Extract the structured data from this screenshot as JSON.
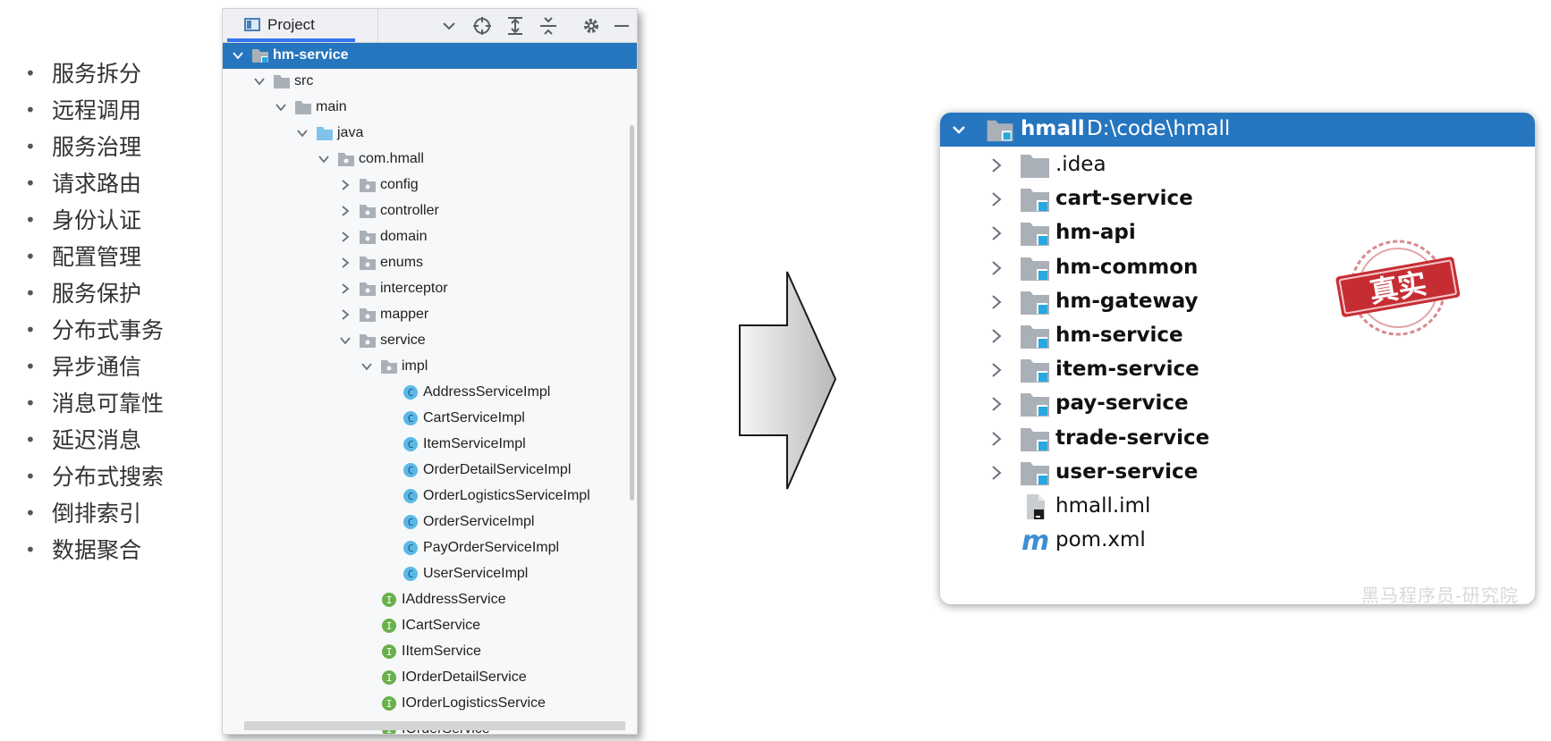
{
  "bullets": [
    "服务拆分",
    "远程调用",
    "服务治理",
    "请求路由",
    "身份认证",
    "配置管理",
    "服务保护",
    "分布式事务",
    "异步通信",
    "消息可靠性",
    "延迟消息",
    "分布式搜索",
    "倒排索引",
    "数据聚合"
  ],
  "project_panel": {
    "tab_label": "Project",
    "toolbar_icons": [
      "chevron-down-icon",
      "locate-icon",
      "expand-all-icon",
      "collapse-all-icon",
      "gear-icon",
      "minimize-icon"
    ],
    "tree": [
      {
        "label": "hm-service",
        "depth": 0,
        "expanded": true,
        "icon": "module-folder-icon",
        "selected": true
      },
      {
        "label": "src",
        "depth": 1,
        "expanded": true,
        "icon": "folder-icon"
      },
      {
        "label": "main",
        "depth": 2,
        "expanded": true,
        "icon": "folder-icon"
      },
      {
        "label": "java",
        "depth": 3,
        "expanded": true,
        "icon": "source-folder-icon"
      },
      {
        "label": "com.hmall",
        "depth": 4,
        "expanded": true,
        "icon": "package-icon"
      },
      {
        "label": "config",
        "depth": 5,
        "expanded": false,
        "icon": "package-icon"
      },
      {
        "label": "controller",
        "depth": 5,
        "expanded": false,
        "icon": "package-icon"
      },
      {
        "label": "domain",
        "depth": 5,
        "expanded": false,
        "icon": "package-icon"
      },
      {
        "label": "enums",
        "depth": 5,
        "expanded": false,
        "icon": "package-icon"
      },
      {
        "label": "interceptor",
        "depth": 5,
        "expanded": false,
        "icon": "package-icon"
      },
      {
        "label": "mapper",
        "depth": 5,
        "expanded": false,
        "icon": "package-icon"
      },
      {
        "label": "service",
        "depth": 5,
        "expanded": true,
        "icon": "package-icon"
      },
      {
        "label": "impl",
        "depth": 6,
        "expanded": true,
        "icon": "package-icon"
      },
      {
        "label": "AddressServiceImpl",
        "depth": 7,
        "icon": "class-icon"
      },
      {
        "label": "CartServiceImpl",
        "depth": 7,
        "icon": "class-icon"
      },
      {
        "label": "ItemServiceImpl",
        "depth": 7,
        "icon": "class-icon"
      },
      {
        "label": "OrderDetailServiceImpl",
        "depth": 7,
        "icon": "class-icon"
      },
      {
        "label": "OrderLogisticsServiceImpl",
        "depth": 7,
        "icon": "class-icon"
      },
      {
        "label": "OrderServiceImpl",
        "depth": 7,
        "icon": "class-icon"
      },
      {
        "label": "PayOrderServiceImpl",
        "depth": 7,
        "icon": "class-icon"
      },
      {
        "label": "UserServiceImpl",
        "depth": 7,
        "icon": "class-icon"
      },
      {
        "label": "IAddressService",
        "depth": 6,
        "icon": "interface-icon"
      },
      {
        "label": "ICartService",
        "depth": 6,
        "icon": "interface-icon"
      },
      {
        "label": "IItemService",
        "depth": 6,
        "icon": "interface-icon"
      },
      {
        "label": "IOrderDetailService",
        "depth": 6,
        "icon": "interface-icon"
      },
      {
        "label": "IOrderLogisticsService",
        "depth": 6,
        "icon": "interface-icon"
      },
      {
        "label": "IOrderService",
        "depth": 6,
        "icon": "interface-icon"
      }
    ]
  },
  "arrow": {
    "icon": "right-arrow-icon"
  },
  "result_panel": {
    "root_name": "hmall",
    "root_path": "D:\\code\\hmall",
    "items": [
      {
        "label": ".idea",
        "icon": "folder-icon",
        "bold": false,
        "chevron": true
      },
      {
        "label": "cart-service",
        "icon": "module-folder-icon",
        "bold": true,
        "chevron": true
      },
      {
        "label": "hm-api",
        "icon": "module-folder-icon",
        "bold": true,
        "chevron": true
      },
      {
        "label": "hm-common",
        "icon": "module-folder-icon",
        "bold": true,
        "chevron": true
      },
      {
        "label": "hm-gateway",
        "icon": "module-folder-icon",
        "bold": true,
        "chevron": true
      },
      {
        "label": "hm-service",
        "icon": "module-folder-icon",
        "bold": true,
        "chevron": true
      },
      {
        "label": "item-service",
        "icon": "module-folder-icon",
        "bold": true,
        "chevron": true
      },
      {
        "label": "pay-service",
        "icon": "module-folder-icon",
        "bold": true,
        "chevron": true
      },
      {
        "label": "trade-service",
        "icon": "module-folder-icon",
        "bold": true,
        "chevron": true
      },
      {
        "label": "user-service",
        "icon": "module-folder-icon",
        "bold": true,
        "chevron": true
      },
      {
        "label": "hmall.iml",
        "icon": "iml-file-icon",
        "bold": false,
        "chevron": false
      },
      {
        "label": "pom.xml",
        "icon": "maven-icon",
        "bold": false,
        "chevron": false
      }
    ]
  },
  "stamp": {
    "text": "真实",
    "icon": "stamp-icon"
  },
  "watermark": "黑马程序员-研究院",
  "colors": {
    "selection": "#2675bf",
    "module_accent": "#29a8e0",
    "folder": "#aab0b8",
    "class_icon": "#5ab8e6",
    "interface_icon": "#6ab04c",
    "stamp": "#c62d33"
  }
}
